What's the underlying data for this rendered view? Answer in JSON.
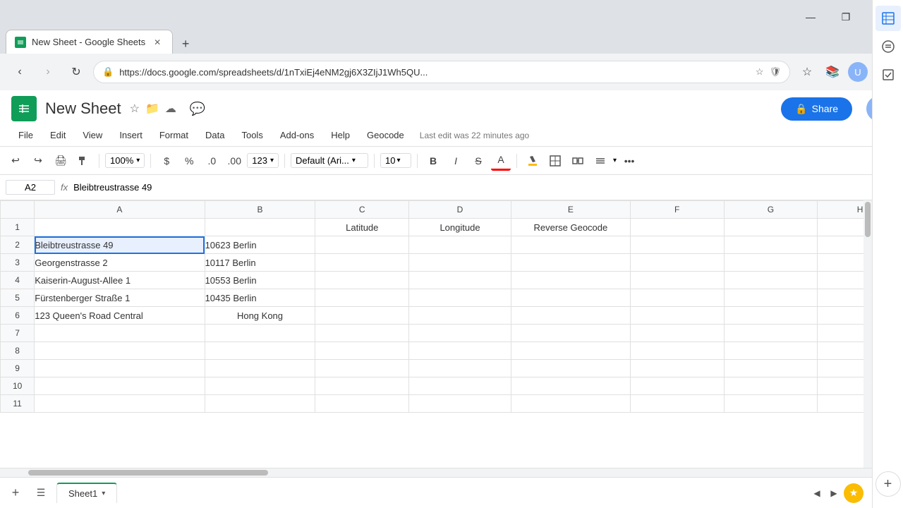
{
  "browser": {
    "tab_title": "New Sheet - Google Sheets",
    "url": "https://docs.google.com/spreadsheets/d/1nTxiEj4eNM2gj6X3ZIjJ1Wh5QU...",
    "favicon_letter": "S",
    "new_tab_icon": "+",
    "back_disabled": false,
    "forward_disabled": true
  },
  "window_controls": {
    "minimize": "—",
    "maximize": "❐",
    "close": "✕"
  },
  "header": {
    "title": "New Sheet",
    "icon_letter": "S",
    "star_icon": "☆",
    "folder_icon": "📁",
    "cloud_icon": "☁",
    "share_label": "Share",
    "last_edit": "Last edit was 22 minutes ago",
    "comment_icon": "💬"
  },
  "menu": {
    "items": [
      "File",
      "Edit",
      "View",
      "Insert",
      "Format",
      "Data",
      "Tools",
      "Add-ons",
      "Help",
      "Geocode"
    ]
  },
  "toolbar": {
    "undo": "↩",
    "redo": "↪",
    "print": "🖨",
    "paint": "🪣",
    "zoom": "100%",
    "currency": "$",
    "percent": "%",
    "decimal_less": ".0",
    "decimal_more": ".00",
    "format_num": "123",
    "font": "Default (Ari...",
    "font_size": "10",
    "bold": "B",
    "italic": "I",
    "strikethrough": "S̶",
    "text_color": "A",
    "fill_color": "◈",
    "borders": "⊞",
    "merge": "⊟",
    "align": "≡",
    "more": "•••",
    "collapse": "∧"
  },
  "formula_bar": {
    "cell_ref": "A2",
    "fx_label": "fx",
    "formula_value": "Bleibtreustrasse 49"
  },
  "columns": {
    "headers": [
      "A",
      "B",
      "C",
      "D",
      "E",
      "F",
      "G",
      "H"
    ],
    "row_numbers": [
      1,
      2,
      3,
      4,
      5,
      6,
      7,
      8,
      9,
      10,
      11
    ]
  },
  "cells": {
    "row1": {
      "a": "",
      "b": "",
      "c": "Latitude",
      "d": "Longitude",
      "e": "Reverse Geocode",
      "f": "",
      "g": "",
      "h": ""
    },
    "row2": {
      "a": "Bleibtreustrasse 49",
      "b": "10623 Berlin",
      "c": "",
      "d": "",
      "e": "",
      "f": "",
      "g": "",
      "h": ""
    },
    "row3": {
      "a": "Georgenstrasse 2",
      "b": "10117 Berlin",
      "c": "",
      "d": "",
      "e": "",
      "f": "",
      "g": "",
      "h": ""
    },
    "row4": {
      "a": "Kaiserin-August-Allee 1",
      "b": "10553 Berlin",
      "c": "",
      "d": "",
      "e": "",
      "f": "",
      "g": "",
      "h": ""
    },
    "row5": {
      "a": "Fürstenberger Straße 1",
      "b": "10435 Berlin",
      "c": "",
      "d": "",
      "e": "",
      "f": "",
      "g": "",
      "h": ""
    },
    "row6": {
      "a": "123 Queen's Road Central",
      "b": "Hong Kong",
      "c": "",
      "d": "",
      "e": "",
      "f": "",
      "g": "",
      "h": ""
    },
    "row7": {
      "a": "",
      "b": "",
      "c": "",
      "d": "",
      "e": "",
      "f": "",
      "g": "",
      "h": ""
    },
    "row8": {
      "a": "",
      "b": "",
      "c": "",
      "d": "",
      "e": "",
      "f": "",
      "g": "",
      "h": ""
    },
    "row9": {
      "a": "",
      "b": "",
      "c": "",
      "d": "",
      "e": "",
      "f": "",
      "g": "",
      "h": ""
    },
    "row10": {
      "a": "",
      "b": "",
      "c": "",
      "d": "",
      "e": "",
      "f": "",
      "g": "",
      "h": ""
    },
    "row11": {
      "a": "",
      "b": "",
      "c": "",
      "d": "",
      "e": "",
      "f": "",
      "g": "",
      "h": ""
    }
  },
  "sheet_tabs": {
    "add_icon": "+",
    "list_icon": "☰",
    "active_sheet": "Sheet1",
    "chevron": "▾",
    "explore_icon": "★",
    "scroll_left": "◀",
    "scroll_right": "▶"
  },
  "side_panel": {
    "chat_icon": "💬",
    "calendar_icon": "📅",
    "check_icon": "✓",
    "plus_icon": "+"
  },
  "colors": {
    "sheets_green": "#0f9d58",
    "selected_blue": "#1a73e8",
    "selected_cell_bg": "#e8f0fe",
    "header_bg": "#f8f9fa",
    "border": "#e0e0e0",
    "share_btn_bg": "#1a73e8",
    "sheet_tab_border": "#0f9d58"
  }
}
